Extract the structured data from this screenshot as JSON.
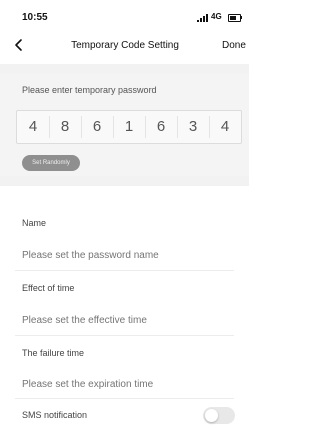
{
  "status_bar": {
    "time": "10:55",
    "network": "4G"
  },
  "nav": {
    "title": "Temporary Code Setting",
    "done_label": "Done"
  },
  "password": {
    "label": "Please enter temporary password",
    "digits": [
      "4",
      "8",
      "6",
      "1",
      "6",
      "3",
      "4"
    ],
    "set_randomly_label": "Set Randomly"
  },
  "form": {
    "name_label": "Name",
    "name_placeholder": "Please set the password name",
    "effect_label": "Effect of time",
    "effect_placeholder": "Please set the effective time",
    "failure_label": "The failure time",
    "failure_placeholder": "Please set the expiration time",
    "sms_label": "SMS notification",
    "sms_enabled": false
  },
  "colors": {
    "button_gray": "#8f8f8f",
    "section_bg": "#f4f4f4",
    "placeholder": "#bbbbbb"
  }
}
